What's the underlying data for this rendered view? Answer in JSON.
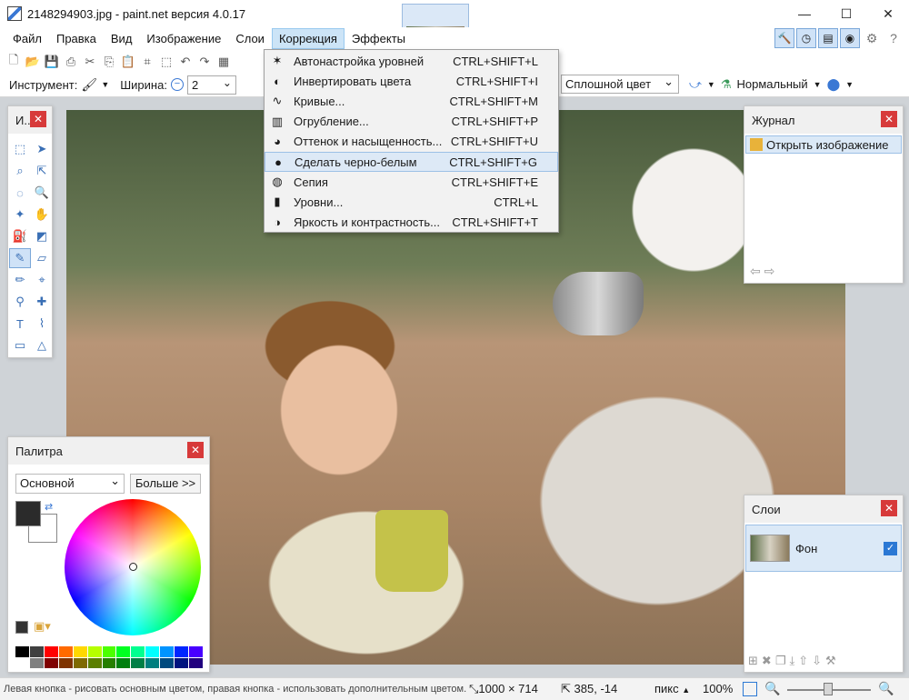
{
  "window": {
    "title": "2148294903.jpg - paint.net версия 4.0.17",
    "min_glyph": "—",
    "max_glyph": "☐",
    "close_glyph": "✕"
  },
  "menubar": {
    "items": [
      "Файл",
      "Правка",
      "Вид",
      "Изображение",
      "Слои",
      "Коррекция",
      "Эффекты"
    ],
    "active_index": 5
  },
  "toolbar": {
    "tool_label": "Инструмент:",
    "width_label": "Ширина:",
    "width_value": "2",
    "fill_mode": "Сплошной цвет",
    "blend_mode": "Нормальный"
  },
  "adjustments_menu": {
    "items": [
      {
        "label": "Автонастройка уровней",
        "shortcut": "CTRL+SHIFT+L",
        "icon": "auto-level-icon"
      },
      {
        "label": "Инвертировать цвета",
        "shortcut": "CTRL+SHIFT+I",
        "icon": "invert-colors-icon"
      },
      {
        "label": "Кривые...",
        "shortcut": "CTRL+SHIFT+M",
        "icon": "curves-icon"
      },
      {
        "label": "Огрубление...",
        "shortcut": "CTRL+SHIFT+P",
        "icon": "posterize-icon"
      },
      {
        "label": "Оттенок и насыщенность...",
        "shortcut": "CTRL+SHIFT+U",
        "icon": "hue-saturation-icon"
      },
      {
        "label": "Сделать черно-белым",
        "shortcut": "CTRL+SHIFT+G",
        "icon": "black-white-icon"
      },
      {
        "label": "Сепия",
        "shortcut": "CTRL+SHIFT+E",
        "icon": "sepia-icon"
      },
      {
        "label": "Уровни...",
        "shortcut": "CTRL+L",
        "icon": "levels-icon"
      },
      {
        "label": "Яркость и контрастность...",
        "shortcut": "CTRL+SHIFT+T",
        "icon": "brightness-contrast-icon"
      }
    ],
    "highlighted_index": 5
  },
  "tools_panel": {
    "title": "И..."
  },
  "palette_panel": {
    "title": "Палитра",
    "mode": "Основной",
    "more_button": "Больше >>",
    "primary_color": "#2b2b2b",
    "secondary_color": "#ffffff",
    "swatches": [
      "#000000",
      "#404040",
      "#ff0000",
      "#ff6a00",
      "#ffd800",
      "#b6ff00",
      "#4cff00",
      "#00ff21",
      "#00ff90",
      "#00ffff",
      "#0094ff",
      "#0026ff",
      "#4800ff",
      "#ffffff",
      "#808080",
      "#7f0000",
      "#7f3300",
      "#7f6a00",
      "#5b7f00",
      "#267f00",
      "#007f0e",
      "#007f46",
      "#007f7f",
      "#004a7f",
      "#00137f",
      "#21007f"
    ]
  },
  "history_panel": {
    "title": "Журнал",
    "items": [
      "Открыть изображение"
    ]
  },
  "layers_panel": {
    "title": "Слои",
    "layers": [
      {
        "name": "Фон",
        "visible": true
      }
    ]
  },
  "statusbar": {
    "hint": "Левая кнопка - рисовать основным цветом, правая кнопка - использовать дополнительным цветом.",
    "image_size": "1000 × 714",
    "cursor_pos": "385, -14",
    "unit": "пикс",
    "zoom": "100%"
  }
}
